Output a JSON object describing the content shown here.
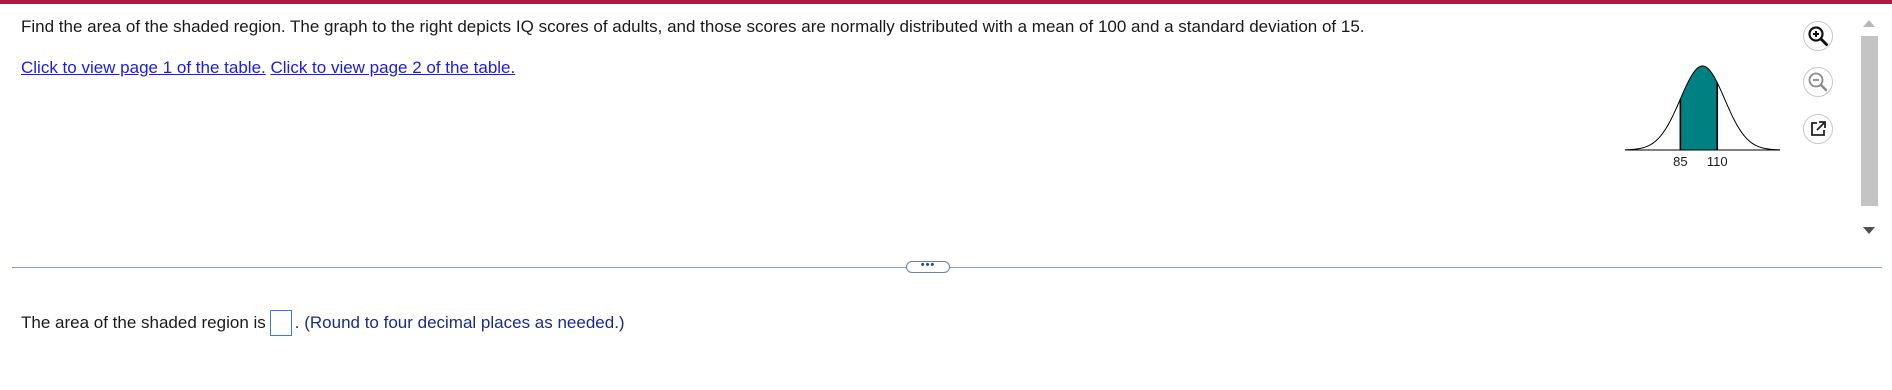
{
  "question": {
    "text": "Find the area of the shaded region. The graph to the right depicts IQ scores of adults, and those scores are normally distributed with a mean of 100 and a standard deviation of 15."
  },
  "links": {
    "table_page1": "Click to view page 1 of the table.",
    "table_page2": "Click to view page 2 of the table."
  },
  "graph": {
    "type": "normal-curve",
    "mean": 100,
    "sd": 15,
    "shaded_from": 85,
    "shaded_to": 110,
    "tick_labels": [
      "85",
      "110"
    ],
    "shade_color": "#008080"
  },
  "tools": [
    "zoom-in-icon",
    "zoom-out-icon",
    "popout-icon"
  ],
  "divider": {
    "expander_label": "•••"
  },
  "answer": {
    "prefix": "The area of the shaded region is",
    "value": "",
    "suffix": ". (Round to four decimal places as needed.)"
  },
  "colors": {
    "accent_bar": "#b3173f",
    "link": "#1a1aee",
    "hint": "#1a2a8c"
  }
}
